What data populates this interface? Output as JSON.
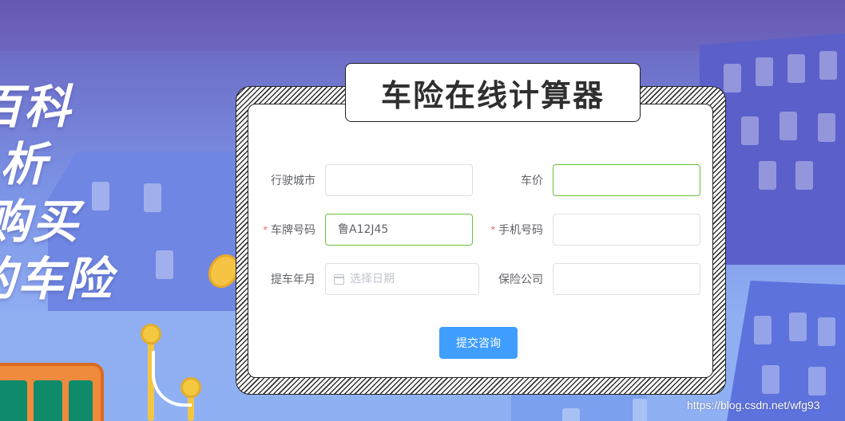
{
  "slogan": {
    "lines": [
      "百科",
      "析",
      "购买",
      "的车险"
    ]
  },
  "title": "车险在线计算器",
  "form": {
    "city": {
      "label": "行驶城市",
      "value": ""
    },
    "price": {
      "label": "车价",
      "value": ""
    },
    "plate": {
      "label": "车牌号码",
      "required_mark": "*",
      "value": "鲁A12J45"
    },
    "phone": {
      "label": "手机号码",
      "required_mark": "*",
      "value": ""
    },
    "pickup_date": {
      "label": "提车年月",
      "placeholder": "选择日期"
    },
    "insurer": {
      "label": "保险公司",
      "value": ""
    },
    "submit_label": "提交咨询"
  },
  "watermark": "https://blog.csdn.net/wfg93",
  "colors": {
    "primary": "#409eff",
    "valid_border": "#67c23a",
    "required": "#f56c6c"
  },
  "icons": [
    "calendar-icon"
  ]
}
